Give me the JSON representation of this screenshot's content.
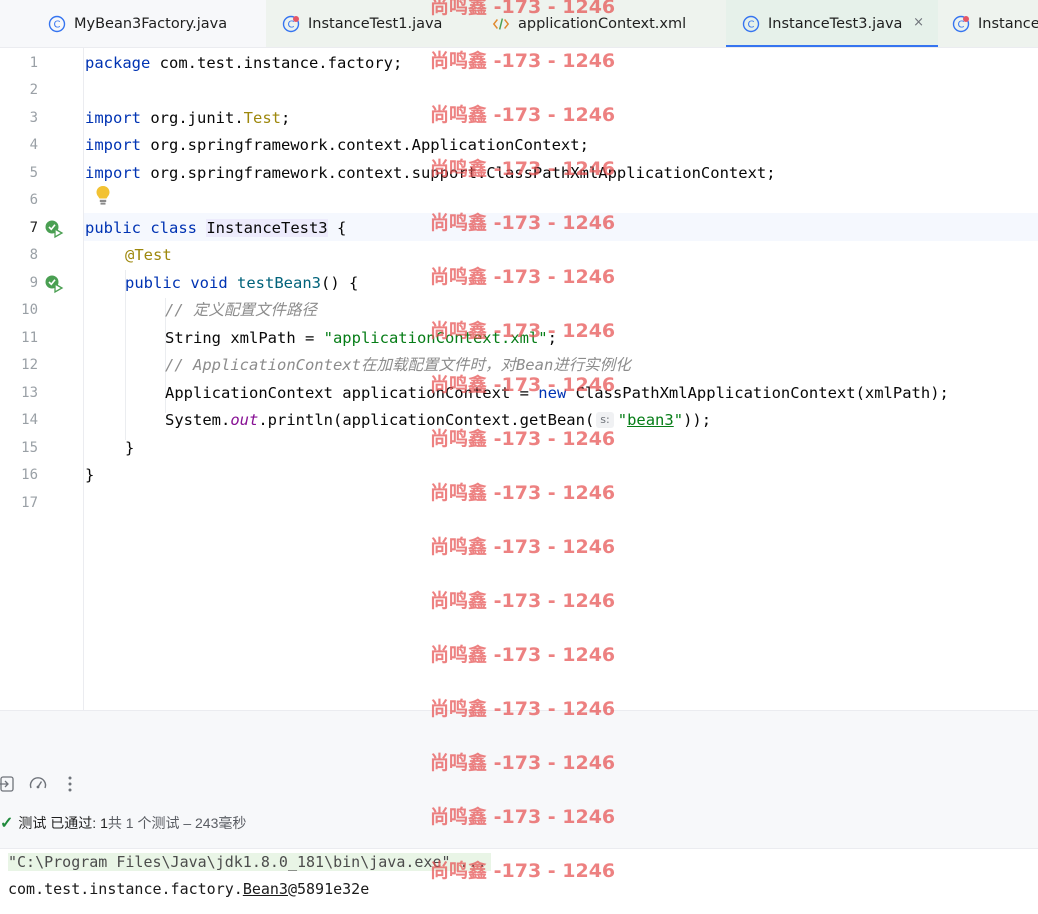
{
  "tabs": [
    {
      "label": "MyBean3Factory.java",
      "icon": "class-icon",
      "active": false
    },
    {
      "label": "InstanceTest1.java",
      "icon": "test-class-icon",
      "active": false
    },
    {
      "label": "applicationContext.xml",
      "icon": "xml-icon",
      "active": false
    },
    {
      "label": "InstanceTest3.java",
      "icon": "class-icon",
      "active": true,
      "close": "×"
    },
    {
      "label": "Instance",
      "icon": "test-class-icon",
      "active": false
    }
  ],
  "editor": {
    "line_numbers": [
      "1",
      "2",
      "3",
      "4",
      "5",
      "6",
      "7",
      "8",
      "9",
      "10",
      "11",
      "12",
      "13",
      "14",
      "15",
      "16",
      "17"
    ],
    "code": {
      "l1_kw": "package",
      "l1_rest": " com.test.instance.factory;",
      "l3_kw": "import",
      "l3_pkg": " org.junit.",
      "l3_cls": "Test",
      "l3_end": ";",
      "l4_kw": "import",
      "l4_rest": " org.springframework.context.ApplicationContext;",
      "l5_kw": "import",
      "l5_rest": " org.springframework.context.support.ClassPathXmlApplicationContext;",
      "l7_kw": "public class",
      "l7_sp": " ",
      "l7_cls": "InstanceTest3",
      "l7_end": " {",
      "l8_ann": "@Test",
      "l9_kw": "public void",
      "l9_sp": " ",
      "l9_mth": "testBean3",
      "l9_end": "() {",
      "l10_cmt": "// 定义配置文件路径",
      "l11_a": "String xmlPath = ",
      "l11_str": "\"applicationContext.xml\"",
      "l11_end": ";",
      "l12_cmt": "// ApplicationContext在加载配置文件时，对Bean进行实例化",
      "l13_a": "ApplicationContext applicationContext = ",
      "l13_kw": "new",
      "l13_end": " ClassPathXmlApplicationContext(xmlPath);",
      "l14_a": "System.",
      "l14_fld": "out",
      "l14_b": ".println(applicationContext.getBean(",
      "l14_hint": "s:",
      "l14_str_q1": "\"",
      "l14_str_v": "bean3",
      "l14_str_q2": "\"",
      "l14_end": "));",
      "l15": "}",
      "l16": "}"
    }
  },
  "run_panel": {
    "status_check": "✓",
    "status_label": "测试 已通过: 1",
    "status_detail": "共 1 个测试 – 243毫秒",
    "console": {
      "cmd": "\"C:\\Program Files\\Java\\jdk1.8.0_181\\bin\\java.exe\" ...",
      "output_a": "com.test.instance.factory.",
      "output_b": "Bean3",
      "output_c": "@5891e32e"
    }
  },
  "watermark": {
    "text": "尚鸣鑫 -173 - 1246"
  }
}
